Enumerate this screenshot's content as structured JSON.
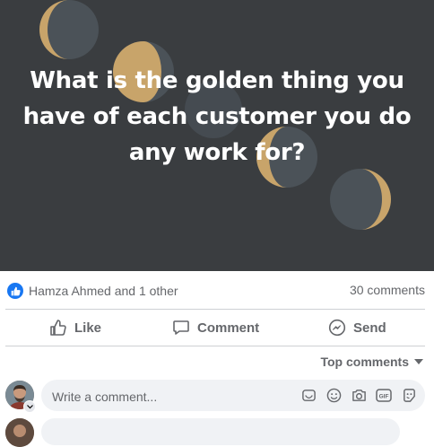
{
  "post": {
    "headline_lines": [
      "What is the golden thing you",
      "have of each customer you do",
      "any work for?"
    ],
    "image_bg": "#3a3d40",
    "moon_gold": "#c8a46a",
    "moon_slate": "#4b5258"
  },
  "reactions": {
    "reaction_icon": "like-thumb-icon",
    "reactors_text": "Hamza Ahmed and 1 other",
    "comments_count": "30 comments"
  },
  "actions": {
    "like_label": "Like",
    "comment_label": "Comment",
    "send_label": "Send"
  },
  "comments_sort": {
    "label": "Top comments",
    "icon": "caret-down-icon"
  },
  "composer": {
    "placeholder": "Write a comment...",
    "tools": [
      "sticker-icon",
      "emoji-icon",
      "camera-icon",
      "gif-icon",
      "avatar-sticker-icon"
    ]
  },
  "colors": {
    "accent": "#1877f2",
    "secondary_text": "#65676b",
    "input_bg": "#f0f2f5"
  }
}
